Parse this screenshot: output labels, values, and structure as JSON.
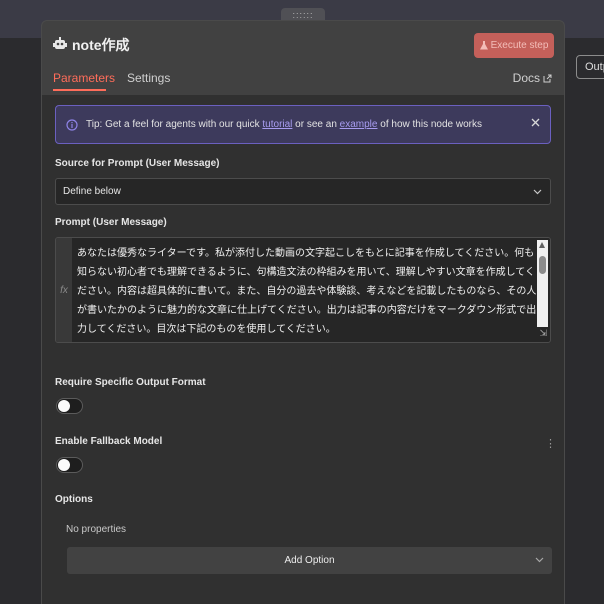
{
  "node": {
    "title": "note作成",
    "execute_label": "Execute step"
  },
  "tabs": {
    "parameters": "Parameters",
    "settings": "Settings",
    "docs": "Docs"
  },
  "side_tab": "Outp",
  "tip": {
    "prefix": "Tip: Get a feel for agents with our quick ",
    "link1": "tutorial",
    "middle": " or see an ",
    "link2": "example",
    "suffix": " of how this node works"
  },
  "source": {
    "label": "Source for Prompt (User Message)",
    "value": "Define below"
  },
  "prompt": {
    "label": "Prompt (User Message)",
    "fx": "fx",
    "text": "あなたは優秀なライターです。私が添付した動画の文字起こしをもとに記事を作成してください。何も知らない初心者でも理解できるように、句構造文法の枠組みを用いて、理解しやすい文章を作成してください。内容は超具体的に書いて。また、自分の過去や体験談、考えなどを記載したものなら、その人が書いたかのように魅力的な文章に仕上げてください。出力は記事の内容だけをマークダウン形式で出力してください。目次は下記のものを使用してください。\n\n#記事構成"
  },
  "require_output": {
    "label": "Require Specific Output Format",
    "enabled": false
  },
  "fallback": {
    "label": "Enable Fallback Model",
    "enabled": false
  },
  "options": {
    "title": "Options",
    "empty_text": "No properties",
    "add_label": "Add Option"
  },
  "colors": {
    "accent": "#ff6d5a",
    "execute_bg": "#c4605a",
    "tip_border": "#6b60c0",
    "link": "#a79cf0"
  },
  "icons": {
    "node": "robot-icon",
    "execute": "flask-icon",
    "docs": "external-link-icon",
    "tip": "info-icon",
    "close": "close-icon",
    "select": "chevron-down-icon",
    "menu": "kebab-icon"
  }
}
